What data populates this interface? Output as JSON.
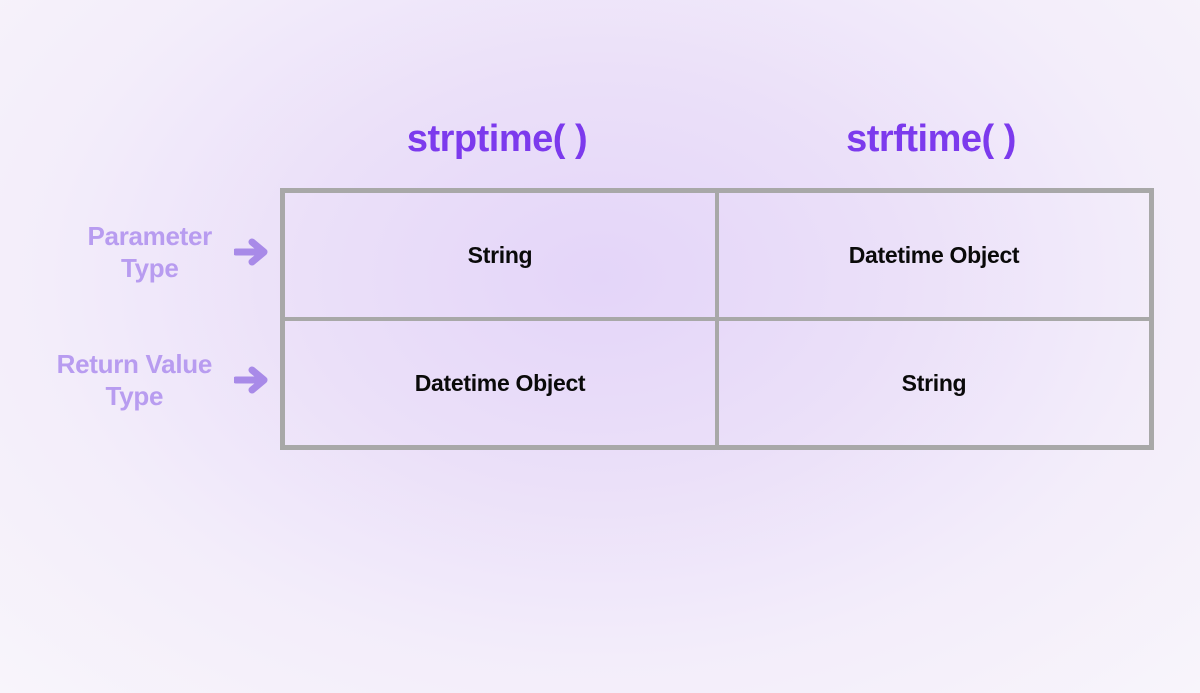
{
  "chart_data": {
    "type": "table",
    "columns": [
      "strptime( )",
      "strftime( )"
    ],
    "rows": [
      "Parameter Type",
      "Return Value Type"
    ],
    "cells": [
      [
        "String",
        "Datetime Object"
      ],
      [
        "Datetime Object",
        "String"
      ]
    ]
  },
  "headers": {
    "col0": "strptime( )",
    "col1": "strftime( )"
  },
  "rowLabels": {
    "row0_line1": "Parameter",
    "row0_line2": "Type",
    "row1_line1": "Return Value",
    "row1_line2": "Type"
  },
  "cells": {
    "r0c0": "String",
    "r0c1": "Datetime Object",
    "r1c0": "Datetime Object",
    "r1c1": "String"
  },
  "colors": {
    "header": "#7c3aed",
    "rowLabel": "#b89cf0",
    "arrow": "#a88ae8",
    "border": "#a8a8a8",
    "cellText": "#0a0a0a"
  }
}
